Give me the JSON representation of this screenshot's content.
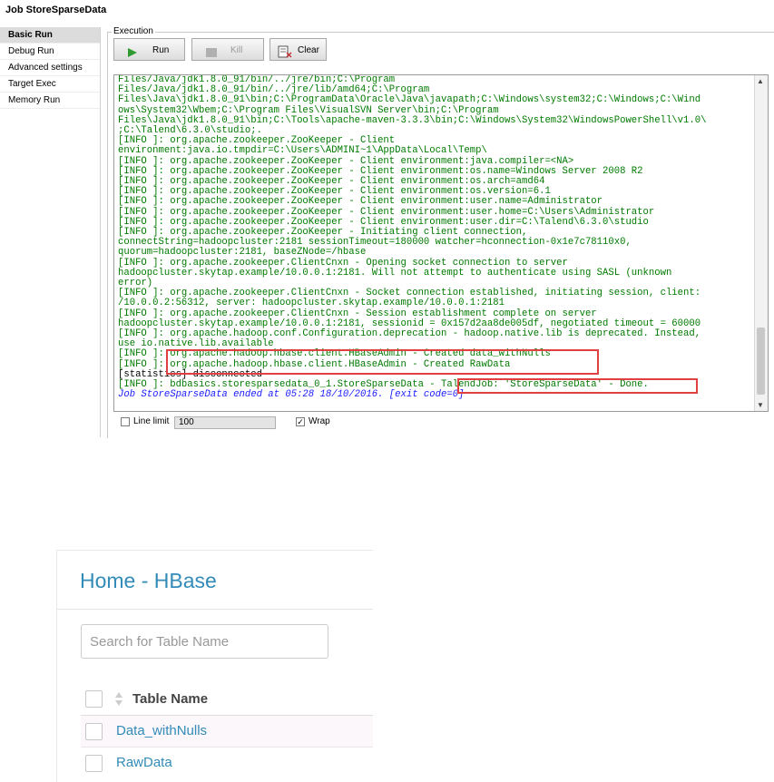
{
  "talend": {
    "job_title": "Job StoreSparseData",
    "sidebar": {
      "items": [
        {
          "label": "Basic Run",
          "active": true
        },
        {
          "label": "Debug Run",
          "active": false
        },
        {
          "label": "Advanced settings",
          "active": false
        },
        {
          "label": "Target Exec",
          "active": false
        },
        {
          "label": "Memory Run",
          "active": false
        }
      ]
    },
    "execution_label": "Execution",
    "toolbar": {
      "run_label": "Run",
      "kill_label": "Kill",
      "clear_label": "Clear"
    },
    "console": {
      "lines": [
        {
          "text": "Files/Java/jdk1.8.0_91/bin/../jre/bin;C:\\Program",
          "color": "green"
        },
        {
          "text": "Files/Java/jdk1.8.0_91/bin/../jre/lib/amd64;C:\\Program",
          "color": "green"
        },
        {
          "text": "Files\\Java\\jdk1.8.0_91\\bin;C:\\ProgramData\\Oracle\\Java\\javapath;C:\\Windows\\system32;C:\\Windows;C:\\Wind",
          "color": "green"
        },
        {
          "text": "ows\\System32\\Wbem;C:\\Program Files\\VisualSVN Server\\bin;C:\\Program",
          "color": "green"
        },
        {
          "text": "Files\\Java\\jdk1.8.0_91\\bin;C:\\Tools\\apache-maven-3.3.3\\bin;C:\\Windows\\System32\\WindowsPowerShell\\v1.0\\",
          "color": "green"
        },
        {
          "text": ";C:\\Talend\\6.3.0\\studio;.",
          "color": "green"
        },
        {
          "text": "[INFO ]: org.apache.zookeeper.ZooKeeper - Client",
          "color": "green"
        },
        {
          "text": "environment:java.io.tmpdir=C:\\Users\\ADMINI~1\\AppData\\Local\\Temp\\",
          "color": "green"
        },
        {
          "text": "[INFO ]: org.apache.zookeeper.ZooKeeper - Client environment:java.compiler=<NA>",
          "color": "green"
        },
        {
          "text": "[INFO ]: org.apache.zookeeper.ZooKeeper - Client environment:os.name=Windows Server 2008 R2",
          "color": "green"
        },
        {
          "text": "[INFO ]: org.apache.zookeeper.ZooKeeper - Client environment:os.arch=amd64",
          "color": "green"
        },
        {
          "text": "[INFO ]: org.apache.zookeeper.ZooKeeper - Client environment:os.version=6.1",
          "color": "green"
        },
        {
          "text": "[INFO ]: org.apache.zookeeper.ZooKeeper - Client environment:user.name=Administrator",
          "color": "green"
        },
        {
          "text": "[INFO ]: org.apache.zookeeper.ZooKeeper - Client environment:user.home=C:\\Users\\Administrator",
          "color": "green"
        },
        {
          "text": "[INFO ]: org.apache.zookeeper.ZooKeeper - Client environment:user.dir=C:\\Talend\\6.3.0\\studio",
          "color": "green"
        },
        {
          "text": "[INFO ]: org.apache.zookeeper.ZooKeeper - Initiating client connection,",
          "color": "green"
        },
        {
          "text": "connectString=hadoopcluster:2181 sessionTimeout=180000 watcher=hconnection-0x1e7c78110x0,",
          "color": "green"
        },
        {
          "text": "quorum=hadoopcluster:2181, baseZNode=/hbase",
          "color": "green"
        },
        {
          "text": "[INFO ]: org.apache.zookeeper.ClientCnxn - Opening socket connection to server",
          "color": "green"
        },
        {
          "text": "hadoopcluster.skytap.example/10.0.0.1:2181. Will not attempt to authenticate using SASL (unknown",
          "color": "green"
        },
        {
          "text": "error)",
          "color": "green"
        },
        {
          "text": "[INFO ]: org.apache.zookeeper.ClientCnxn - Socket connection established, initiating session, client:",
          "color": "green"
        },
        {
          "text": "/10.0.0.2:56312, server: hadoopcluster.skytap.example/10.0.0.1:2181",
          "color": "green"
        },
        {
          "text": "[INFO ]: org.apache.zookeeper.ClientCnxn - Session establishment complete on server",
          "color": "green"
        },
        {
          "text": "hadoopcluster.skytap.example/10.0.0.1:2181, sessionid = 0x157d2aa8de005df, negotiated timeout = 60000",
          "color": "green"
        },
        {
          "text": "[INFO ]: org.apache.hadoop.conf.Configuration.deprecation - hadoop.native.lib is deprecated. Instead,",
          "color": "green"
        },
        {
          "text": "use io.native.lib.available",
          "color": "green"
        },
        {
          "text": "[INFO ]: org.apache.hadoop.hbase.client.HBaseAdmin - Created data_withNulls",
          "color": "green"
        },
        {
          "text": "[INFO ]: org.apache.hadoop.hbase.client.HBaseAdmin - Created RawData",
          "color": "green"
        },
        {
          "text": "[statistics] disconnected",
          "color": "black"
        },
        {
          "text": "[INFO ]: bdbasics.storesparsedata_0_1.StoreSparseData - TalendJob: 'StoreSparseData' - Done.",
          "color": "green"
        },
        {
          "text": "Job StoreSparseData ended at 05:28 18/10/2016. [exit code=0]",
          "color": "blue"
        }
      ]
    },
    "options": {
      "line_limit_label": "Line limit",
      "line_limit_checked": false,
      "line_limit_value": "100",
      "wrap_label": "Wrap",
      "wrap_checked": true
    },
    "colors": {
      "console_green": "#007a00",
      "console_blue": "#1a1aff",
      "highlight_red": "#e04040"
    }
  },
  "hue": {
    "title": "Home - HBase",
    "search": {
      "placeholder": "Search for Table Name",
      "value": ""
    },
    "table": {
      "header": "Table Name",
      "rows": [
        {
          "name": "Data_withNulls"
        },
        {
          "name": "RawData"
        }
      ]
    },
    "colors": {
      "link_blue": "#338bb8"
    }
  }
}
